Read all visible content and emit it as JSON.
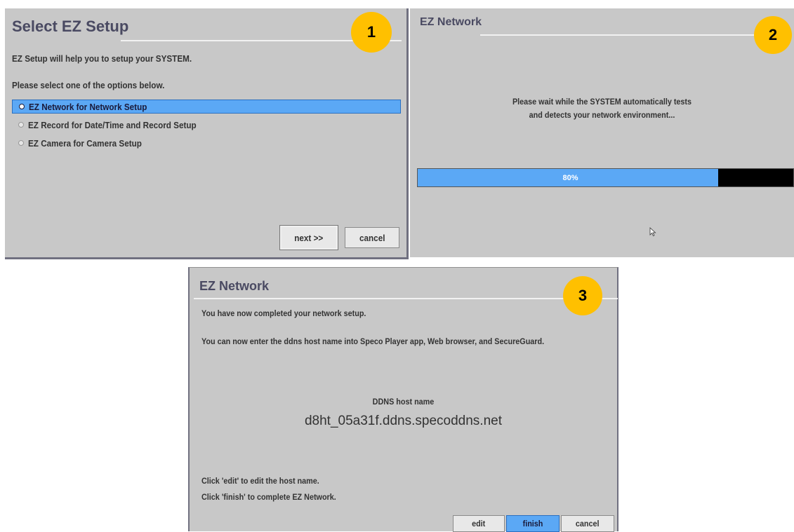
{
  "panel1": {
    "badge": "1",
    "title": "Select EZ Setup",
    "intro": "EZ Setup will help you to setup your SYSTEM.",
    "prompt": "Please select one of the options below.",
    "options": [
      {
        "label": "EZ Network for Network Setup",
        "selected": true
      },
      {
        "label": "EZ Record for Date/Time and Record Setup",
        "selected": false
      },
      {
        "label": "EZ Camera for Camera Setup",
        "selected": false
      }
    ],
    "next_label": "next >>",
    "cancel_label": "cancel"
  },
  "panel2": {
    "badge": "2",
    "title": "EZ Network",
    "message_line1": "Please wait while the SYSTEM automatically tests",
    "message_line2": "and detects your network environment...",
    "progress_percent": 80,
    "progress_label": "80%"
  },
  "panel3": {
    "badge": "3",
    "title": "EZ Network",
    "line1": "You have now completed your network setup.",
    "line2": "You can now enter the ddns host name into Speco Player app, Web browser, and SecureGuard.",
    "host_label": "DDNS host name",
    "host_value": "d8ht_05a31f.ddns.specoddns.net",
    "hint_edit": "Click 'edit' to edit the host name.",
    "hint_finish": "Click 'finish' to complete EZ Network.",
    "edit_label": "edit",
    "finish_label": "finish",
    "cancel_label": "cancel"
  },
  "colors": {
    "panel_bg": "#c8c8c8",
    "selection_blue": "#5ba8f5",
    "badge_yellow": "#ffc000",
    "title_text": "#4a4a62"
  }
}
